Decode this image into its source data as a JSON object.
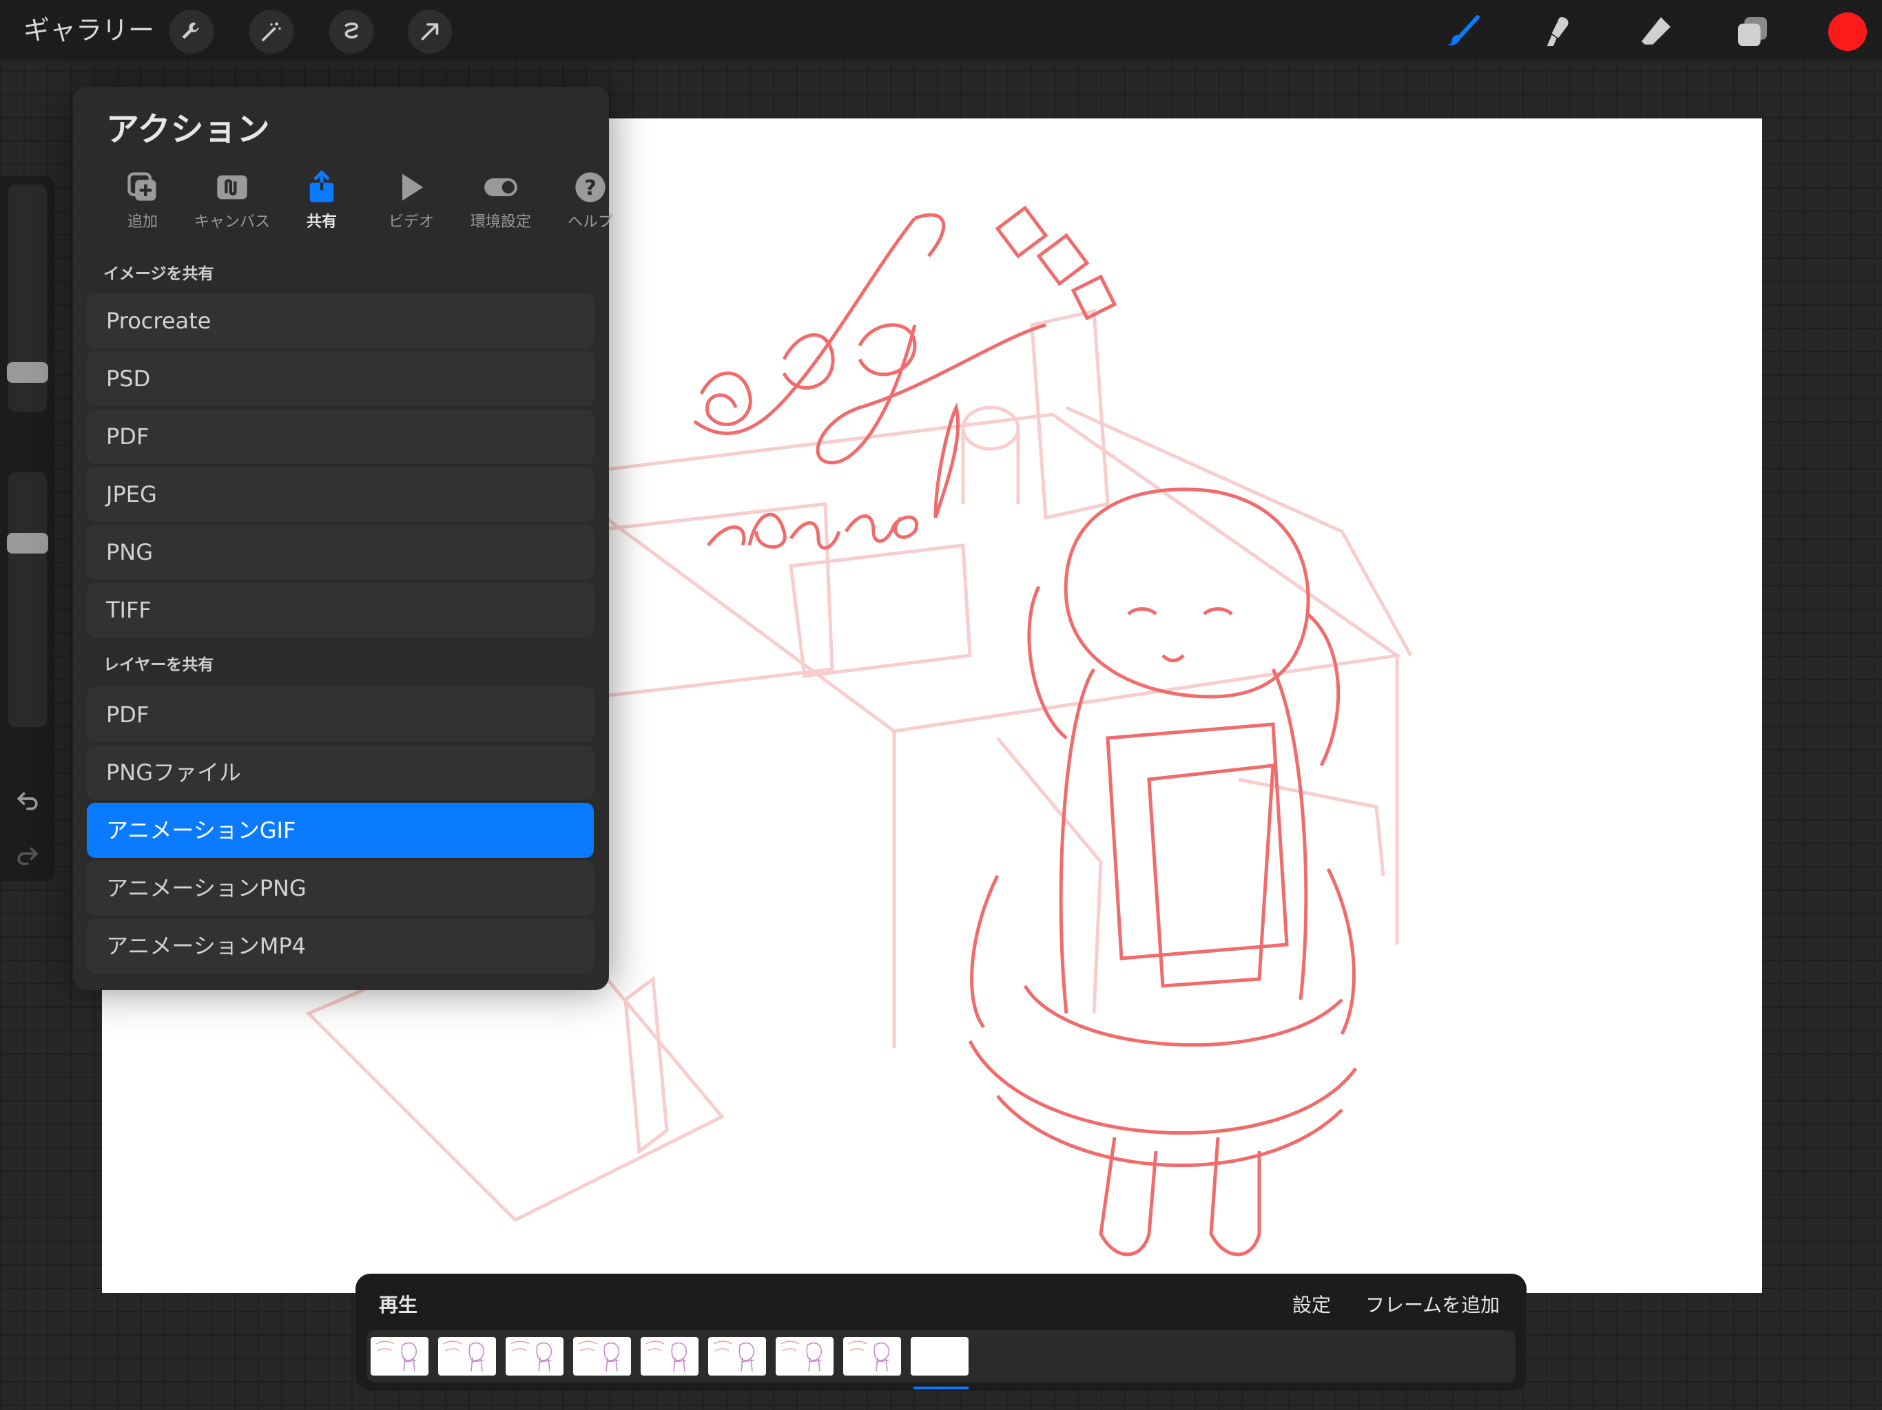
{
  "topbar": {
    "gallery_label": "ギャラリー",
    "buttons": [
      "wrench-icon",
      "magic-wand-icon",
      "selection-icon",
      "transform-arrow-icon"
    ],
    "tools": [
      "brush-icon",
      "smudge-icon",
      "eraser-icon",
      "layers-icon"
    ],
    "current_color": "#ff1a1a"
  },
  "actions_panel": {
    "title": "アクション",
    "tabs": [
      {
        "label": "追加",
        "icon": "add-image-icon",
        "active": false
      },
      {
        "label": "キャンバス",
        "icon": "canvas-icon",
        "active": false
      },
      {
        "label": "共有",
        "icon": "share-icon",
        "active": true
      },
      {
        "label": "ビデオ",
        "icon": "play-icon",
        "active": false
      },
      {
        "label": "環境設定",
        "icon": "toggle-icon",
        "active": false
      },
      {
        "label": "ヘルプ",
        "icon": "help-icon",
        "active": false
      }
    ],
    "section_image": "イメージを共有",
    "image_items": [
      "Procreate",
      "PSD",
      "PDF",
      "JPEG",
      "PNG",
      "TIFF"
    ],
    "section_layers": "レイヤーを共有",
    "layer_items": [
      "PDF",
      "PNGファイル",
      "アニメーションGIF",
      "アニメーションPNG",
      "アニメーションMP4"
    ],
    "selected_item": "アニメーションGIF"
  },
  "timeline": {
    "play_label": "再生",
    "settings_label": "設定",
    "add_frame_label": "フレームを追加",
    "frame_count": 9,
    "selected_frame": 9
  },
  "canvas": {
    "sketch_text_1": "ralog",
    "sketch_text_2": "hannel",
    "ink_color": "#f06b6b"
  },
  "accent_color": "#0a7aff"
}
